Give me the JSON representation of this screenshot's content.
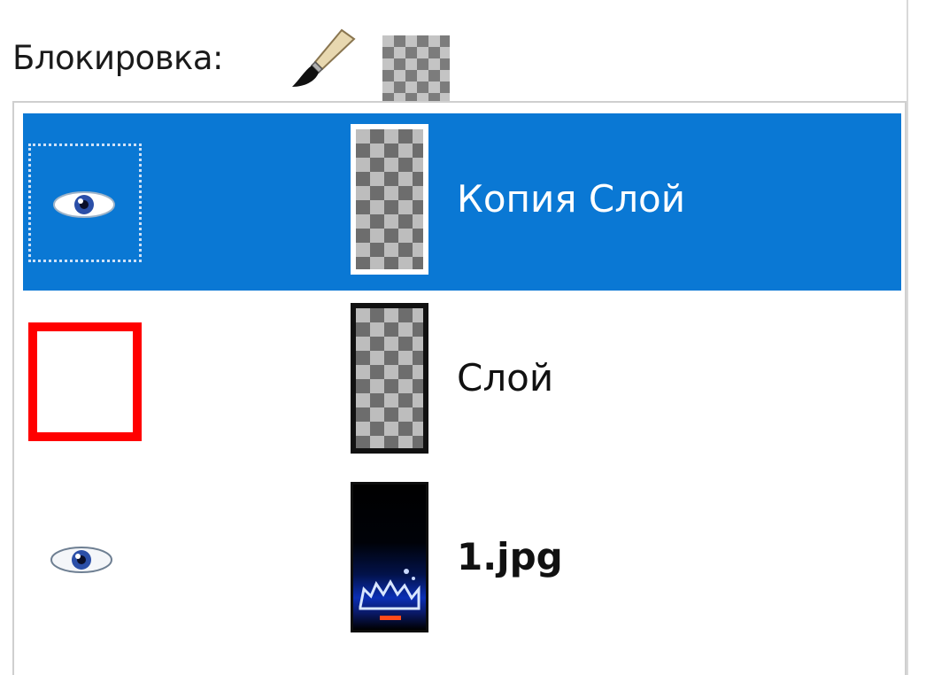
{
  "lock_bar": {
    "label": "Блокировка:",
    "icons": [
      "lock-pixels-brush-icon",
      "lock-alpha-checkerboard-icon"
    ]
  },
  "layers": [
    {
      "name": "Копия Слой",
      "visible": true,
      "selected": true,
      "thumbnail": "transparent-checkerboard",
      "bold": false
    },
    {
      "name": "Слой",
      "visible": false,
      "selected": false,
      "thumbnail": "transparent-checkerboard",
      "bold": false,
      "highlighted_eye_cell": true
    },
    {
      "name": "1.jpg",
      "visible": true,
      "selected": false,
      "thumbnail": "dark-blue-photo",
      "bold": true
    }
  ],
  "colors": {
    "selection": "#0a78d4",
    "highlight_box": "#ff0000"
  }
}
